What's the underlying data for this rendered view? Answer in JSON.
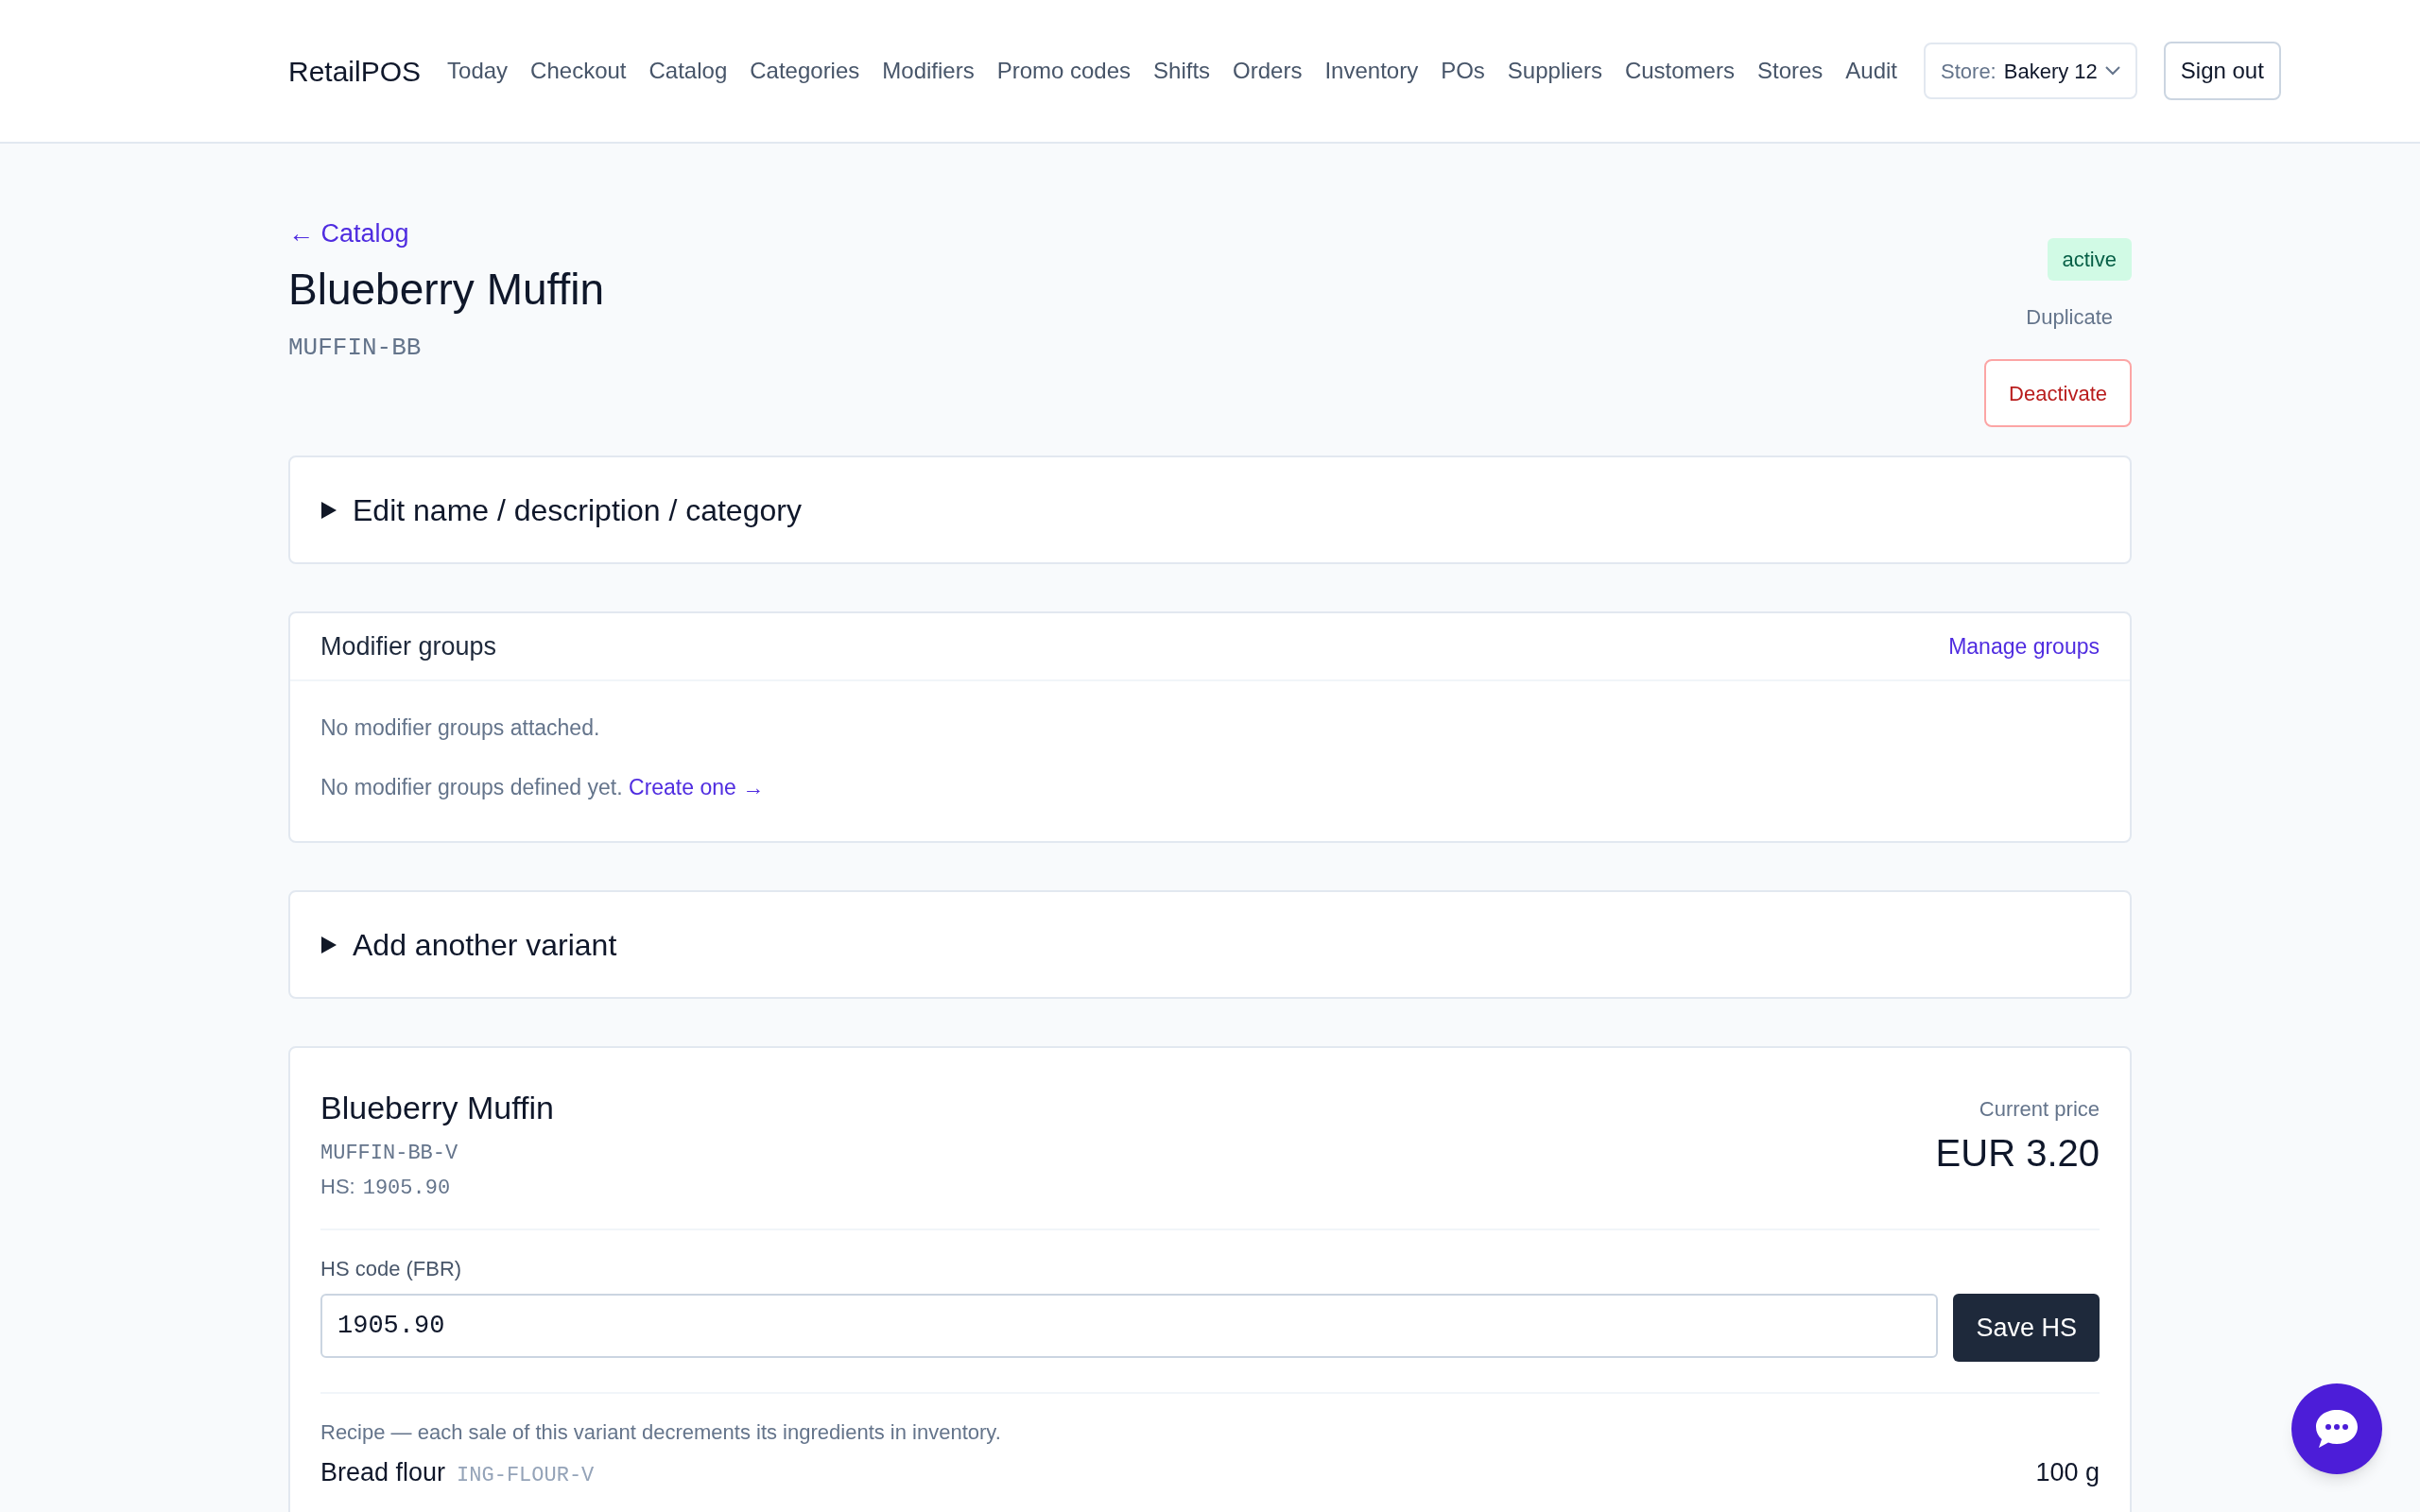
{
  "header": {
    "brand": "RetailPOS",
    "nav": [
      "Today",
      "Checkout",
      "Catalog",
      "Categories",
      "Modifiers",
      "Promo codes",
      "Shifts",
      "Orders",
      "Inventory",
      "POs",
      "Suppliers",
      "Customers",
      "Stores",
      "Audit"
    ],
    "store_select": {
      "label": "Store:",
      "value": "Bakery 12"
    },
    "sign_out": "Sign out"
  },
  "back_link": "← Catalog",
  "product": {
    "name": "Blueberry Muffin",
    "sku": "MUFFIN-BB",
    "status": "active",
    "actions": [
      "Duplicate",
      "Deactivate"
    ]
  },
  "sections": [
    {
      "kind": "disclosure",
      "title": "Edit name / description / category",
      "expanded": false
    },
    {
      "kind": "card",
      "title": "Modifier groups",
      "link": "Manage groups",
      "empty_text": "No modifier groups attached.",
      "hint": "No modifier groups defined yet.",
      "hint_link": "Create one →"
    },
    {
      "kind": "disclosure",
      "title": "Add another variant",
      "expanded": false
    }
  ],
  "variant": {
    "name": "Blueberry Muffin",
    "sku": "MUFFIN-BB-V",
    "hs_label": "HS:",
    "hs_value": "1905.90",
    "price_label": "Current price",
    "price": "EUR 3.20",
    "hs_field": {
      "label": "HS code (FBR)",
      "value": "1905.90"
    },
    "save_button": "Save HS",
    "recipe_note": "Recipe — each sale of this variant decrements its ingredients in inventory.",
    "ingredients": [
      {
        "name": "Bread flour",
        "code": "ING-FLOUR-V",
        "quantity": "100 g"
      }
    ]
  }
}
